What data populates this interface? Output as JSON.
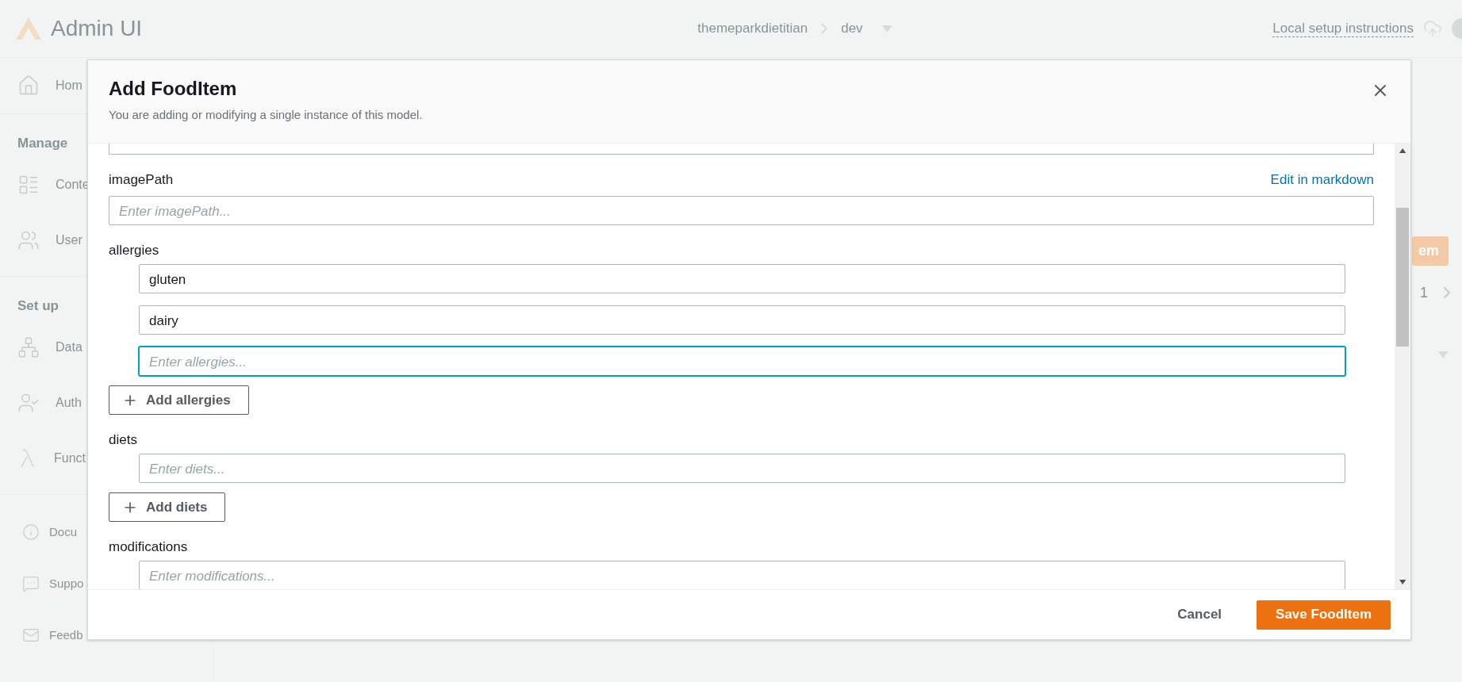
{
  "topbar": {
    "app_name": "Admin UI",
    "breadcrumb": [
      "themeparkdietitian",
      "dev"
    ],
    "link": "Local setup instructions"
  },
  "sidebar": {
    "sections": [
      {
        "items": [
          {
            "label": "Hom"
          }
        ]
      },
      {
        "heading": "Manage",
        "items": [
          {
            "label": "Conte"
          },
          {
            "label": "User"
          }
        ]
      },
      {
        "heading": "Set up",
        "items": [
          {
            "label": "Data"
          },
          {
            "label": "Auth"
          },
          {
            "label": "Funct"
          }
        ]
      },
      {
        "kind": "footer",
        "items": [
          {
            "label": "Docu"
          },
          {
            "label": "Suppo"
          },
          {
            "label": "Feedb"
          }
        ]
      }
    ]
  },
  "background_panel": {
    "button": "em",
    "page": "1"
  },
  "dialog": {
    "title": "Add FoodItem",
    "subtitle": "You are adding or modifying a single instance of this model.",
    "fields": [
      {
        "kind": "text",
        "label": "imagePath",
        "placeholder": "Enter imagePath...",
        "action": "Edit in markdown"
      },
      {
        "kind": "list",
        "label": "allergies",
        "items": [
          {
            "value": "gluten",
            "focused": false
          },
          {
            "value": "dairy",
            "focused": false
          },
          {
            "placeholder": "Enter allergies...",
            "focused": true
          }
        ],
        "add_button": "Add allergies"
      },
      {
        "kind": "list",
        "label": "diets",
        "items": [
          {
            "placeholder": "Enter diets...",
            "focused": false
          }
        ],
        "add_button": "Add diets"
      },
      {
        "kind": "list",
        "label": "modifications",
        "items": [
          {
            "placeholder": "Enter modifications...",
            "focused": false
          }
        ]
      }
    ],
    "buttons": [
      {
        "kind": "link",
        "label": "Cancel"
      },
      {
        "kind": "primary",
        "label": "Save FoodItem"
      }
    ]
  }
}
